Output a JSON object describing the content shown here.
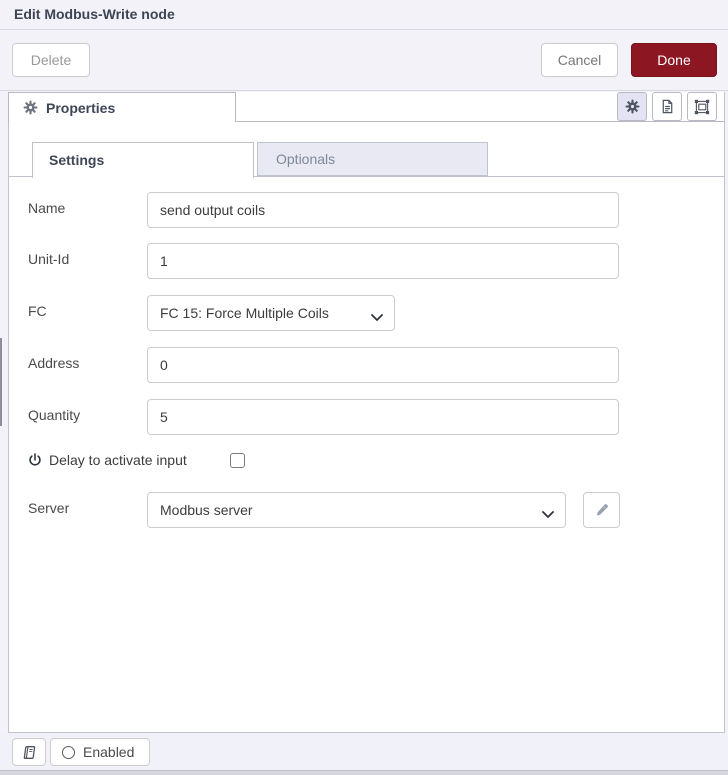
{
  "header": {
    "title": "Edit Modbus-Write node"
  },
  "toolbar": {
    "delete_label": "Delete",
    "cancel_label": "Cancel",
    "done_label": "Done"
  },
  "tray": {
    "properties_label": "Properties",
    "icon_buttons": [
      "gear-icon",
      "description-icon",
      "appearance-icon"
    ],
    "active_icon": "gear-icon"
  },
  "tabs": {
    "settings_label": "Settings",
    "optionals_label": "Optionals"
  },
  "form": {
    "name": {
      "label": "Name",
      "value": "send output coils"
    },
    "unit_id": {
      "label": "Unit-Id",
      "value": "1"
    },
    "fc": {
      "label": "FC",
      "value": "FC 15: Force Multiple Coils"
    },
    "address": {
      "label": "Address",
      "value": "0"
    },
    "quantity": {
      "label": "Quantity",
      "value": "5"
    },
    "delay": {
      "label": "Delay to activate input",
      "checked": false
    },
    "server": {
      "label": "Server",
      "value": "Modbus server"
    }
  },
  "footer": {
    "enabled_label": "Enabled"
  },
  "colors": {
    "done_button": "#8c1722",
    "tray_background": "#f2f2f8",
    "active_icon_background": "#e3e3f3",
    "inactive_tab_background": "#e9e9f3"
  }
}
